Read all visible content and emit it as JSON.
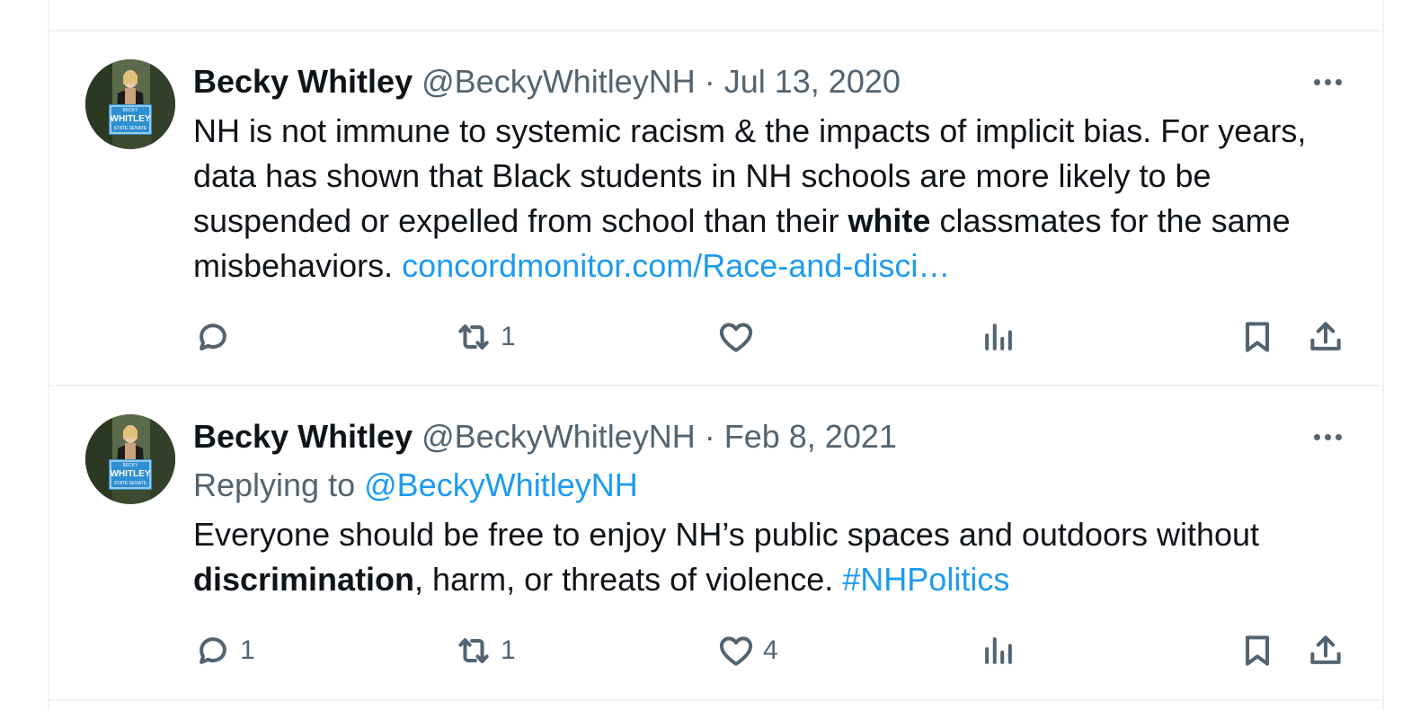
{
  "tweets": [
    {
      "name": "Becky Whitley",
      "handle": "@BeckyWhitleyNH",
      "separator": "·",
      "date": "Jul 13, 2020",
      "text_1": "NH is not immune to systemic racism & the impacts of implicit bias. For years, data has shown that Black students in NH schools are more likely to be suspended or expelled from school than their ",
      "text_bold": "white",
      "text_2": " classmates for the same misbehaviors. ",
      "link": "concordmonitor.com/Race-and-disci…",
      "replies": "",
      "retweets": "1",
      "likes": "",
      "avatar_sign_top": "BECKY",
      "avatar_sign_main": "WHITLEY",
      "avatar_sign_bottom": "STATE SENATE"
    },
    {
      "name": "Becky Whitley",
      "handle": "@BeckyWhitleyNH",
      "separator": "·",
      "date": "Feb 8, 2021",
      "replying_label": "Replying to ",
      "replying_handle": "@BeckyWhitleyNH",
      "text_1": "Everyone should be free to enjoy NH’s public spaces and outdoors without ",
      "text_bold": "discrimination",
      "text_2": ", harm, or threats of violence. ",
      "hashtag": "#NHPolitics",
      "replies": "1",
      "retweets": "1",
      "likes": "4",
      "avatar_sign_top": "BECKY",
      "avatar_sign_main": "WHITLEY",
      "avatar_sign_bottom": "STATE SENATE"
    }
  ],
  "icons": {
    "reply": "reply-icon",
    "retweet": "retweet-icon",
    "like": "heart-icon",
    "views": "analytics-icon",
    "bookmark": "bookmark-icon",
    "share": "share-icon",
    "more": "more-icon"
  },
  "colors": {
    "link": "#1d9bf0",
    "muted": "#536471",
    "text": "#0f1419",
    "border": "#eff3f4"
  }
}
